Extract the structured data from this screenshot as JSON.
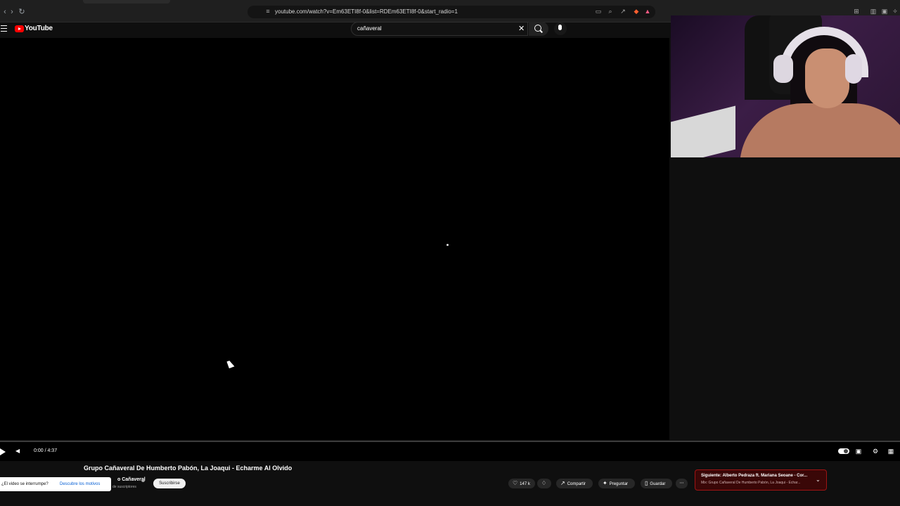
{
  "browser": {
    "url": "youtube.com/watch?v=Em63ETI8f-0&list=RDEm63ETI8f-0&start_radio=1"
  },
  "youtube": {
    "logo": "YouTube",
    "search": {
      "value": "cañaveral",
      "clear": "✕"
    },
    "player": {
      "time": "0:00 / 4:37"
    },
    "video": {
      "title": "Grupo Cañaveral De Humberto Pabón, La Joaqui - Echarme Al Olvido",
      "channel": "o Cañaveral",
      "subscribers": "de suscriptores",
      "subscribe": "Suscribirse",
      "interrupt_text": "¿El video se interrumpe?",
      "discover_link": "Descubre los motivos"
    },
    "actions": {
      "likes": "147 k",
      "share": "Compartir",
      "ask": "Preguntar",
      "save": "Guardar",
      "more": "⋯"
    },
    "next": {
      "title": "Siguiente: Alberto Pedraza ft. Mariana Seoane - Cor...",
      "subtitle": "Mix: Grupo Cañaveral De Humberto Pabón, La Joaqui - Echar..."
    }
  },
  "icons": {
    "menu": "menu-icon",
    "search": "search-icon",
    "mic": "mic-icon",
    "play": "play-icon",
    "volume": "volume-icon",
    "like": "thumb-up-icon",
    "dislike": "thumb-down-icon",
    "share": "share-icon",
    "ask": "sparkle-icon",
    "save": "bookmark-icon"
  },
  "colors": {
    "background": "#0f0f0f",
    "brand": "#ff0000",
    "next_card": "#3a0707"
  }
}
